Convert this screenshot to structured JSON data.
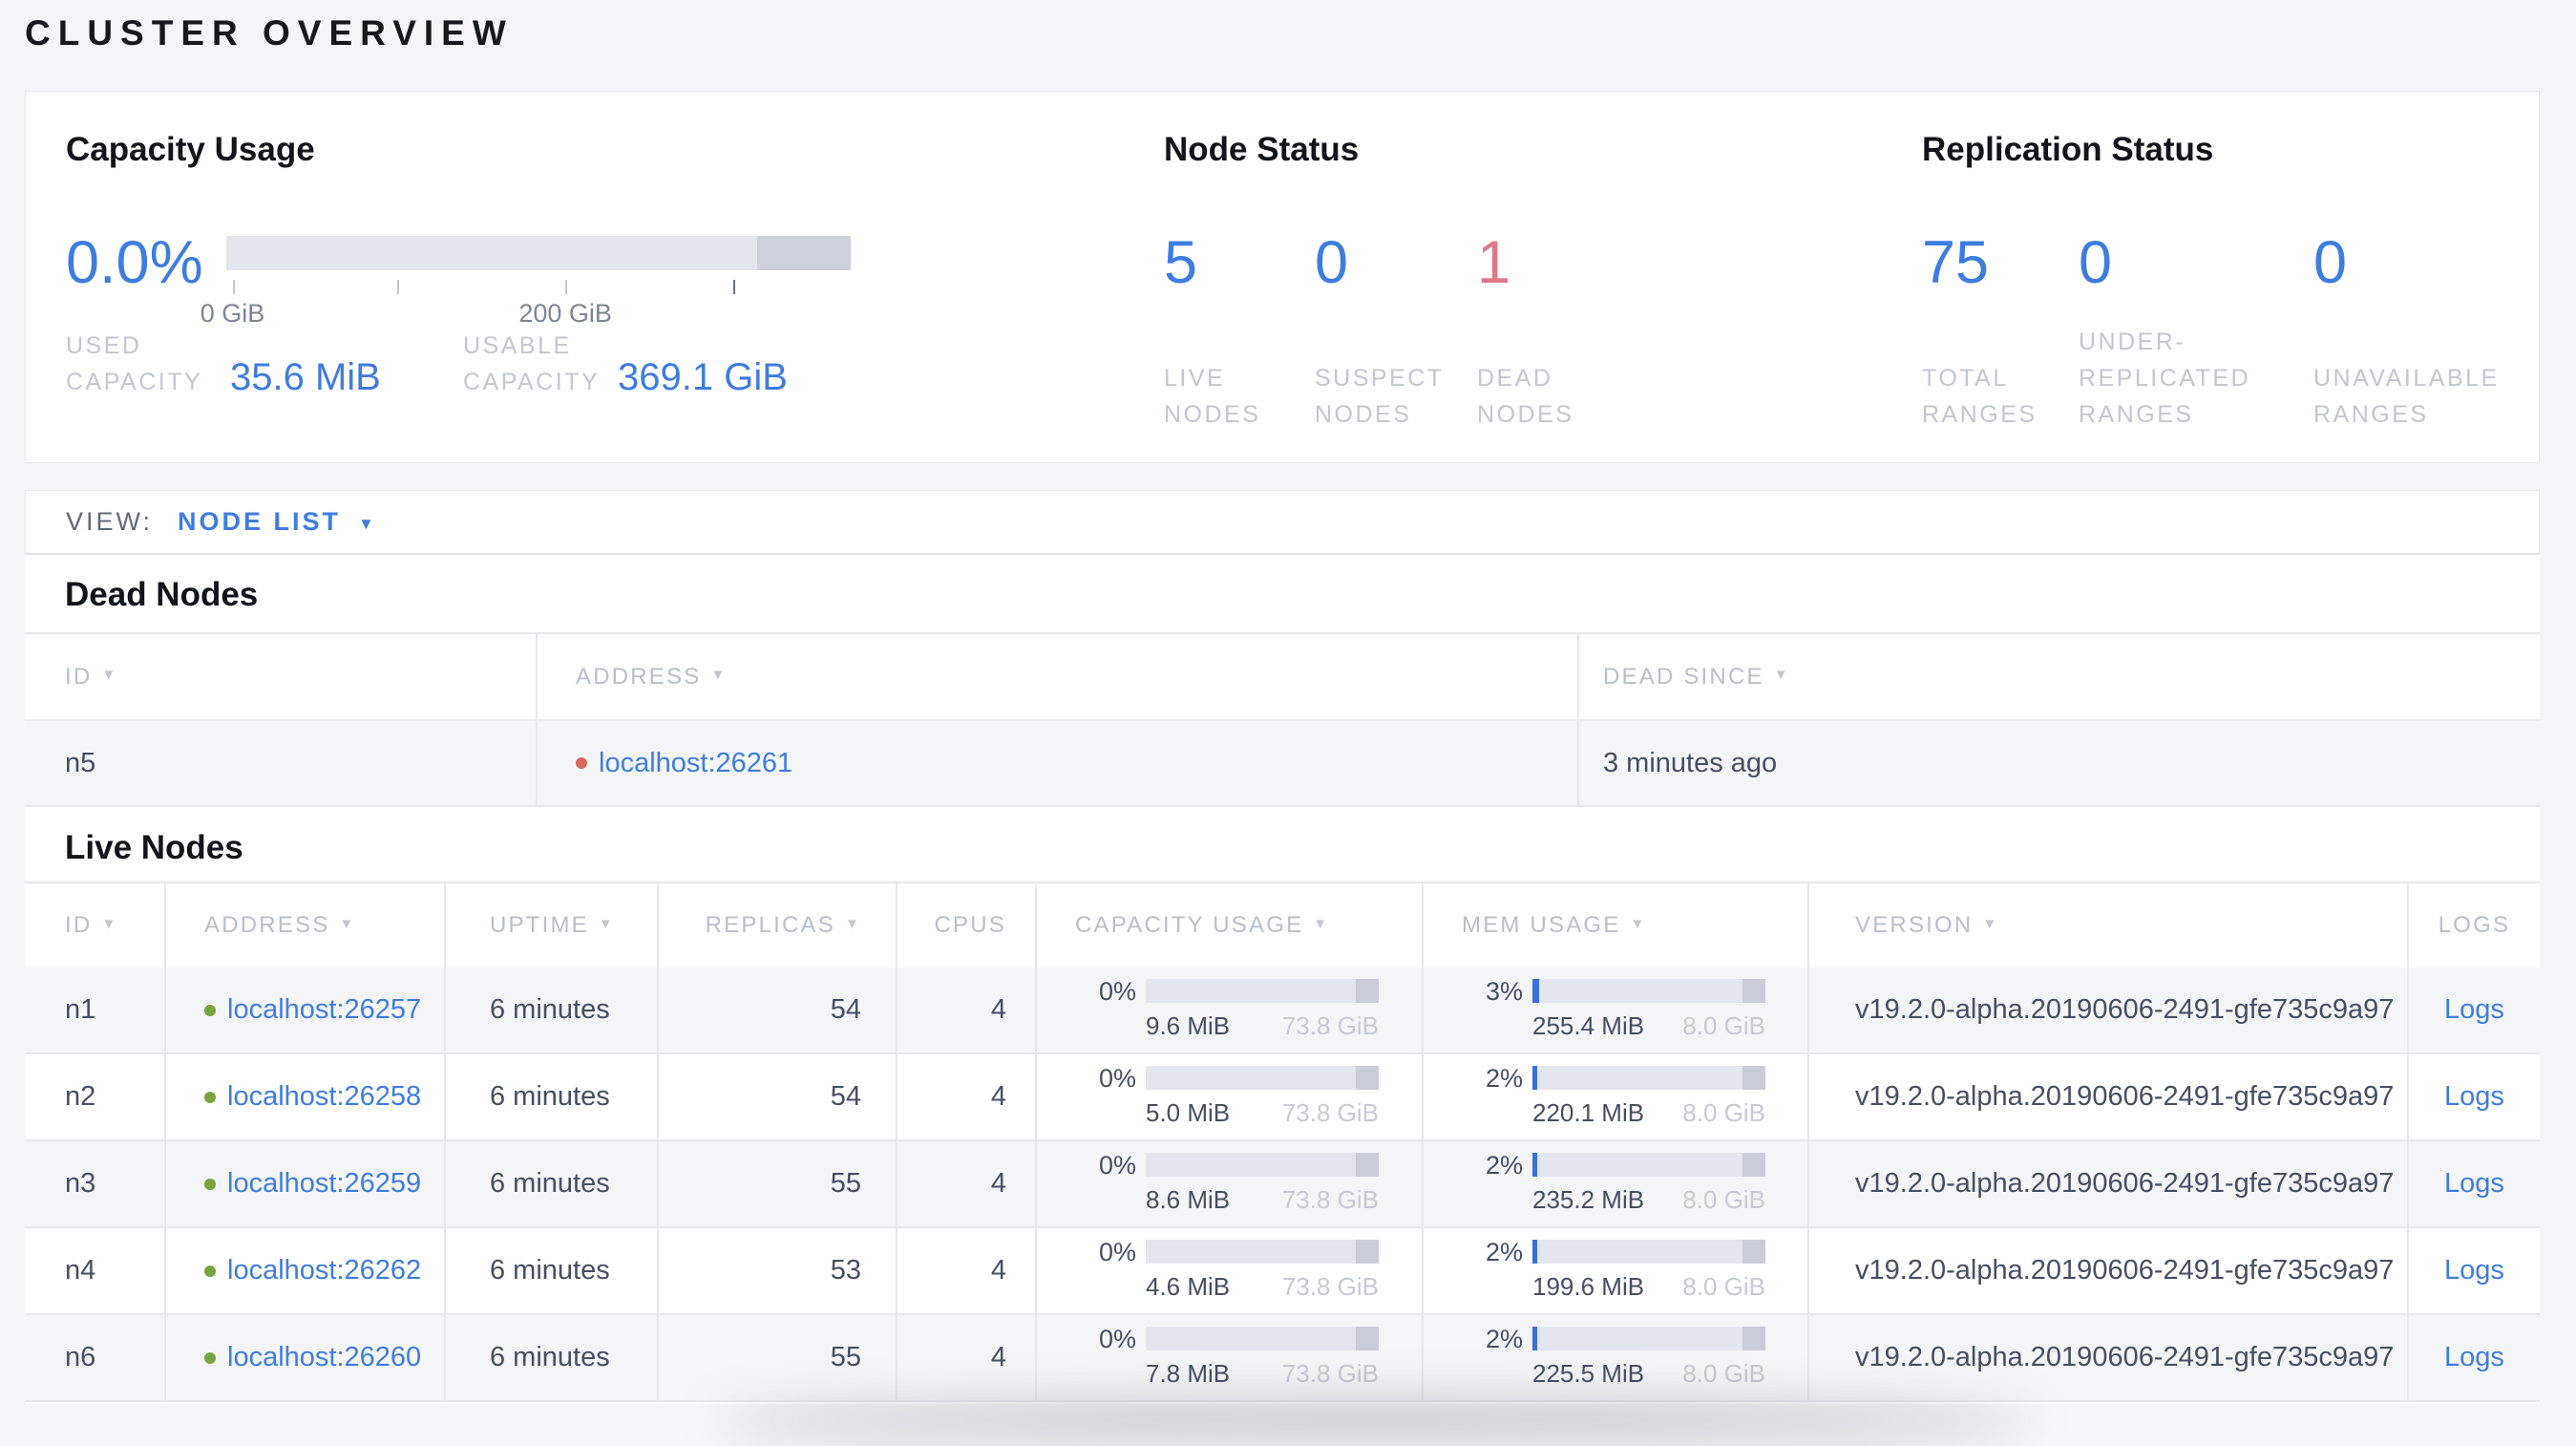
{
  "page_title": "CLUSTER OVERVIEW",
  "colors": {
    "accent_blue": "#3e7de0",
    "danger_red": "#e07986",
    "live_dot_green": "#77a43b",
    "dead_dot_red": "#d8685f"
  },
  "icons": {
    "sort_arrow": "▼",
    "caret_down": "▼"
  },
  "summary": {
    "capacity": {
      "title": "Capacity Usage",
      "percent": "0.0%",
      "axis_ticks": [
        "0 GiB",
        "200 GiB"
      ],
      "used_label": "USED CAPACITY",
      "used_value": "35.6 MiB",
      "usable_label": "USABLE CAPACITY",
      "usable_value": "369.1 GiB"
    },
    "nodes": {
      "title": "Node Status",
      "stats": [
        {
          "value": "5",
          "label": "LIVE NODES"
        },
        {
          "value": "0",
          "label": "SUSPECT NODES"
        },
        {
          "value": "1",
          "label": "DEAD NODES"
        }
      ]
    },
    "replication": {
      "title": "Replication Status",
      "stats": [
        {
          "value": "75",
          "label": "TOTAL RANGES"
        },
        {
          "value": "0",
          "label": "UNDER-REPLICATED RANGES"
        },
        {
          "value": "0",
          "label": "UNAVAILABLE RANGES"
        }
      ]
    }
  },
  "view_bar": {
    "label": "VIEW:",
    "selected": "NODE LIST"
  },
  "dead_nodes": {
    "title": "Dead Nodes",
    "columns": [
      {
        "label": "ID"
      },
      {
        "label": "ADDRESS"
      },
      {
        "label": "DEAD SINCE"
      }
    ],
    "rows": [
      {
        "id": "n5",
        "address": "localhost:26261",
        "dead_since": "3 minutes ago"
      }
    ]
  },
  "live_nodes": {
    "title": "Live Nodes",
    "columns": [
      {
        "label": "ID"
      },
      {
        "label": "ADDRESS"
      },
      {
        "label": "UPTIME"
      },
      {
        "label": "REPLICAS"
      },
      {
        "label": "CPUS"
      },
      {
        "label": "CAPACITY USAGE"
      },
      {
        "label": "MEM USAGE"
      },
      {
        "label": "VERSION"
      },
      {
        "label": "LOGS"
      }
    ],
    "rows": [
      {
        "id": "n1",
        "address": "localhost:26257",
        "uptime": "6 minutes",
        "replicas": "54",
        "cpus": "4",
        "capacity": {
          "percent": "0%",
          "used": "9.6 MiB",
          "total": "73.8 GiB"
        },
        "mem": {
          "percent": "3%",
          "used": "255.4 MiB",
          "total": "8.0 GiB"
        },
        "version": "v19.2.0-alpha.20190606-2491-gfe735c9a97",
        "logs_label": "Logs"
      },
      {
        "id": "n2",
        "address": "localhost:26258",
        "uptime": "6 minutes",
        "replicas": "54",
        "cpus": "4",
        "capacity": {
          "percent": "0%",
          "used": "5.0 MiB",
          "total": "73.8 GiB"
        },
        "mem": {
          "percent": "2%",
          "used": "220.1 MiB",
          "total": "8.0 GiB"
        },
        "version": "v19.2.0-alpha.20190606-2491-gfe735c9a97",
        "logs_label": "Logs"
      },
      {
        "id": "n3",
        "address": "localhost:26259",
        "uptime": "6 minutes",
        "replicas": "55",
        "cpus": "4",
        "capacity": {
          "percent": "0%",
          "used": "8.6 MiB",
          "total": "73.8 GiB"
        },
        "mem": {
          "percent": "2%",
          "used": "235.2 MiB",
          "total": "8.0 GiB"
        },
        "version": "v19.2.0-alpha.20190606-2491-gfe735c9a97",
        "logs_label": "Logs"
      },
      {
        "id": "n4",
        "address": "localhost:26262",
        "uptime": "6 minutes",
        "replicas": "53",
        "cpus": "4",
        "capacity": {
          "percent": "0%",
          "used": "4.6 MiB",
          "total": "73.8 GiB"
        },
        "mem": {
          "percent": "2%",
          "used": "199.6 MiB",
          "total": "8.0 GiB"
        },
        "version": "v19.2.0-alpha.20190606-2491-gfe735c9a97",
        "logs_label": "Logs"
      },
      {
        "id": "n6",
        "address": "localhost:26260",
        "uptime": "6 minutes",
        "replicas": "55",
        "cpus": "4",
        "capacity": {
          "percent": "0%",
          "used": "7.8 MiB",
          "total": "73.8 GiB"
        },
        "mem": {
          "percent": "2%",
          "used": "225.5 MiB",
          "total": "8.0 GiB"
        },
        "version": "v19.2.0-alpha.20190606-2491-gfe735c9a97",
        "logs_label": "Logs"
      }
    ]
  }
}
